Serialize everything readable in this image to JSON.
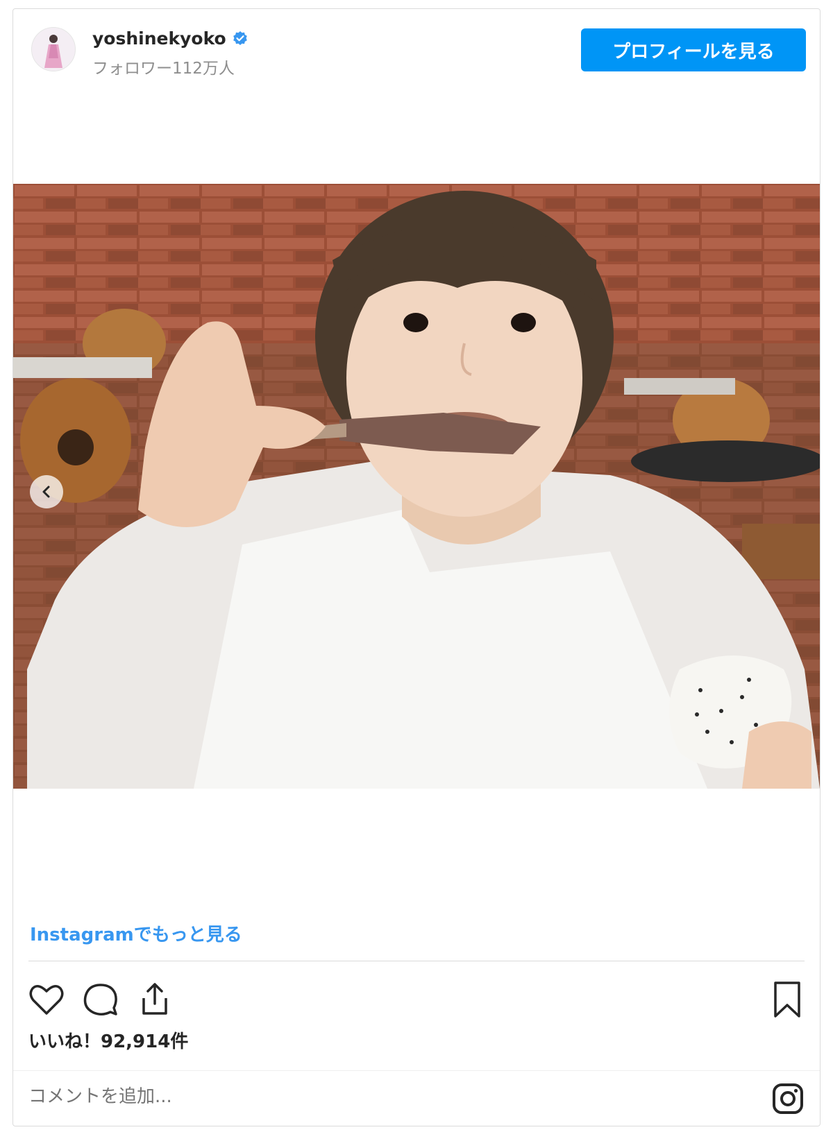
{
  "header": {
    "username": "yoshinekyoko",
    "followers": "フォロワー112万人",
    "profile_button": "プロフィールを見る"
  },
  "post": {
    "more_link": "Instagramでもっと見る",
    "likes": "いいね！92,914件",
    "comment_placeholder": "コメントを追加..."
  },
  "colors": {
    "accent": "#0095f6",
    "link": "#3897f0",
    "text": "#262626",
    "muted": "#8e8e8e",
    "border": "#dbdbdb"
  },
  "icons": [
    "verified-badge-icon",
    "chevron-left-icon",
    "heart-icon",
    "comment-icon",
    "share-icon",
    "bookmark-icon",
    "instagram-icon"
  ]
}
